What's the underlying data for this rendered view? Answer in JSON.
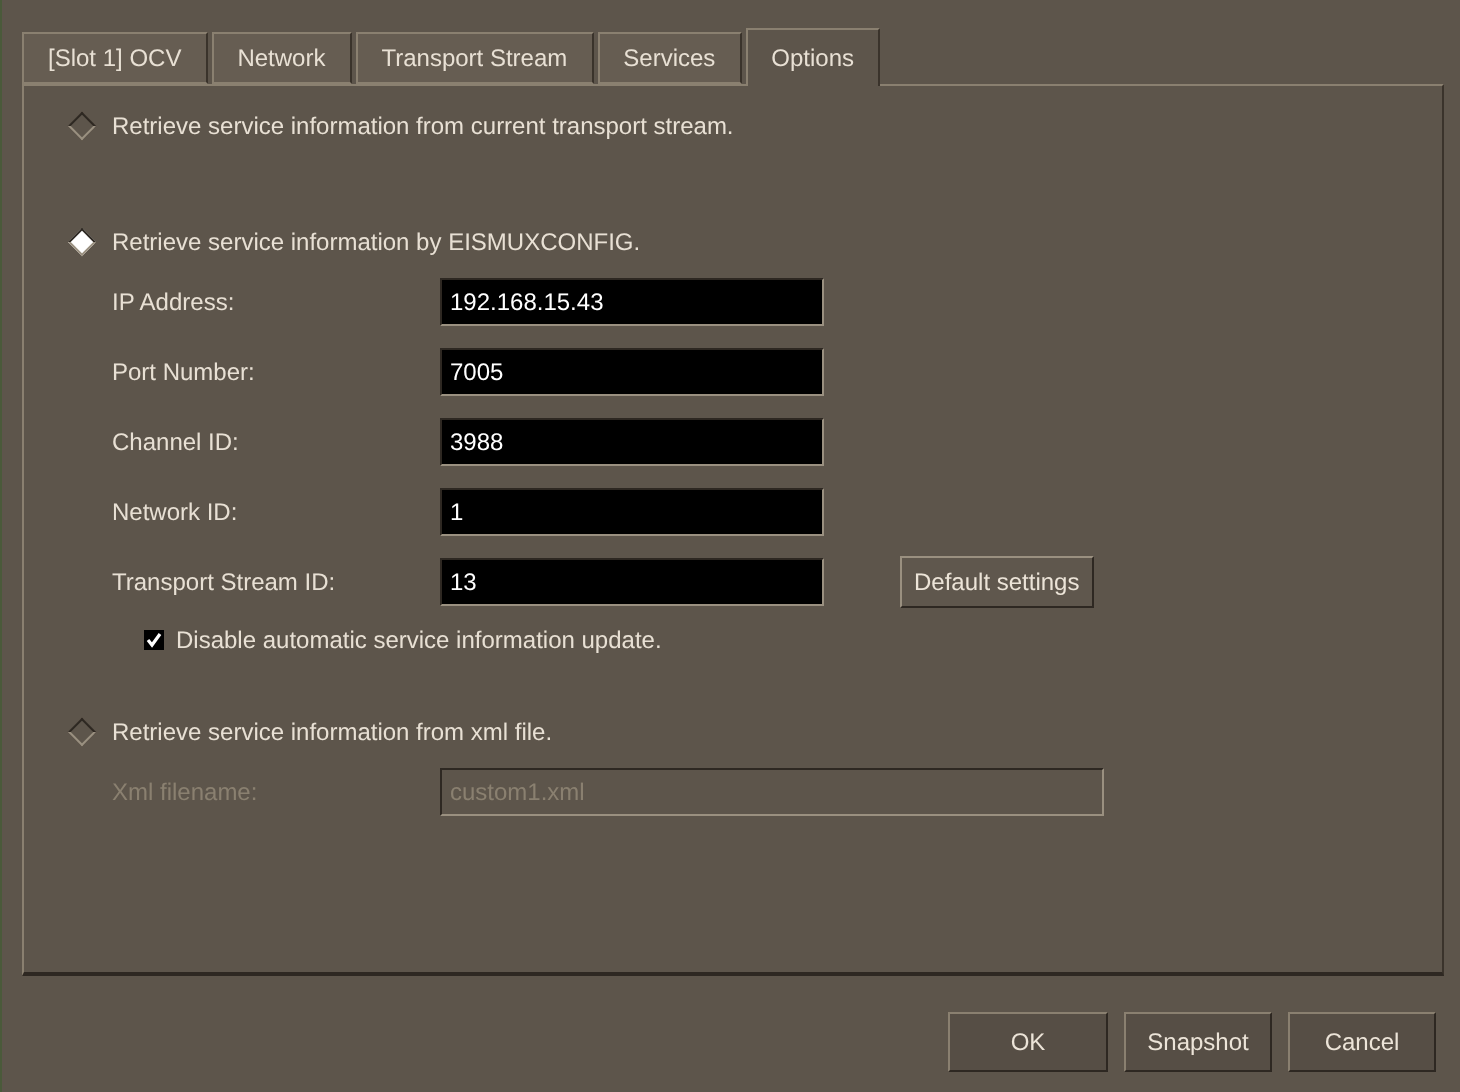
{
  "tabs": [
    {
      "label": "[Slot 1] OCV",
      "selected": false
    },
    {
      "label": "Network",
      "selected": false
    },
    {
      "label": "Transport Stream",
      "selected": false
    },
    {
      "label": "Services",
      "selected": false
    },
    {
      "label": "Options",
      "selected": true
    }
  ],
  "sources": [
    {
      "label": "Retrieve service information from current transport stream.",
      "selected": false
    },
    {
      "label": "Retrieve service information by EISMUXCONFIG.",
      "selected": true,
      "fields": [
        {
          "label": "IP Address:",
          "value": "192.168.15.43"
        },
        {
          "label": "Port Number:",
          "value": "7005"
        },
        {
          "label": "Channel ID:",
          "value": "3988"
        },
        {
          "label": "Network ID:",
          "value": "1"
        },
        {
          "label": "Transport Stream ID:",
          "value": "13"
        }
      ],
      "default_button": "Default settings",
      "checkbox": {
        "label": "Disable automatic service information update.",
        "checked": true
      }
    },
    {
      "label": "Retrieve service information from xml file.",
      "selected": false,
      "xml_field": {
        "label": "Xml filename:",
        "value": "custom1.xml",
        "disabled": true
      }
    }
  ],
  "buttons": [
    "OK",
    "Snapshot",
    "Cancel"
  ]
}
